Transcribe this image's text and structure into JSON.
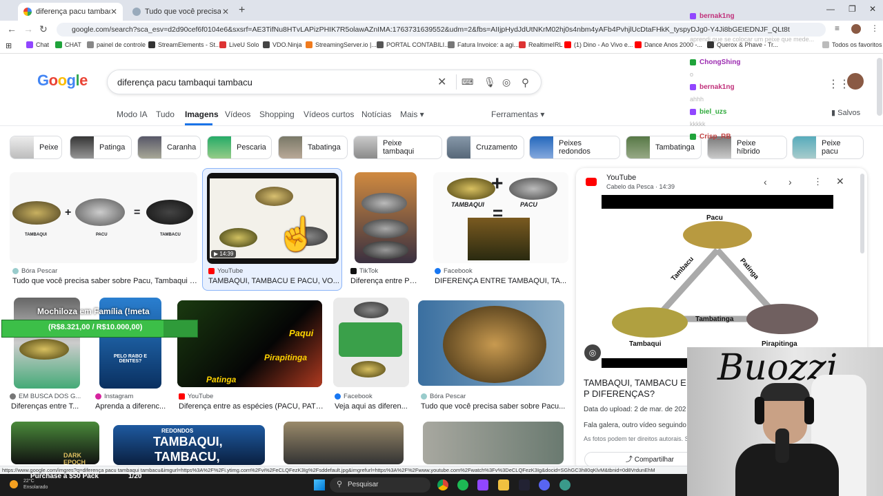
{
  "browser": {
    "tabs": [
      {
        "title": "diferença pacu tambaqui tamba",
        "active": true
      },
      {
        "title": "Tudo que você precisa saber sob",
        "active": false
      }
    ],
    "url": "google.com/search?sca_esv=d2d90cef6f0104e6&sxsrf=AE3TifNu8HTvLAPizPHIK7R5olawAZnIMA:1763731639552&udm=2&fbs=AIIjpHydJdUtNKrM02hj0s4nbm4yAFb4PvhjlUcDtaFHkK_tyspyDJg0-Y4Ji8bGEtEDNJF_QLt8t",
    "status_url": "https://www.google.com/imgres?q=diferença pacu tambaqui tambacu&imgurl=https%3A%2F%2Fi.ytimg.com%2Fvi%2FeCLQFezK3Ig%2Fsddefault.jpg&imgrefurl=https%3A%2F%2Fwww.youtube.com%2Fwatch%3Fv%3DeCLQFezK3Ig&docid=SGhGC3h80qKlvM&tbnid=0d8VrdunEhM",
    "bookmarks": [
      "Chat",
      "CHAT",
      "painel de controle",
      "StreamElements - St...",
      "LiveU Solo",
      "VDO.Ninja",
      "StreamingServer.io |...",
      "PORTAL CONTABILI...",
      "Fatura Invoice: a agi...",
      "RealtimeIRL",
      "(1) Dino - Ao Vivo e...",
      "Dance Anos 2000 -...",
      "Querox & Phave - Tr..."
    ],
    "bookmarks_all": "Todos os favoritos"
  },
  "google": {
    "logo": "Google",
    "query": "diferença pacu tambaqui tambacu",
    "tabs": [
      "Modo IA",
      "Tudo",
      "Imagens",
      "Vídeos",
      "Shopping",
      "Vídeos curtos",
      "Notícias",
      "Mais"
    ],
    "active_tab": "Imagens",
    "tools": "Ferramentas",
    "saved": "Salvos",
    "chips": [
      "Peixe",
      "Patinga",
      "Caranha",
      "Pescaria",
      "Tabatinga",
      "Peixe tambaqui",
      "Cruzamento",
      "Peixes redondos",
      "Tambatinga",
      "Peixe híbrido",
      "Peixe pacu"
    ],
    "results_row1": [
      {
        "source": "Bóra Pescar",
        "title": "Tudo que você precisa saber sobre Pacu, Tambaqui e..."
      },
      {
        "source": "YouTube",
        "title": "TAMBAQUI, TAMBACU E PACU, VO...",
        "duration": "14:39"
      },
      {
        "source": "TikTok",
        "title": "Diferença entre Pa..."
      },
      {
        "source": "Facebook",
        "title": "DIFERENÇA ENTRE TAMBAQUI, TA..."
      }
    ],
    "results_row2": [
      {
        "source": "EM BUSCA DOS G...",
        "title": "Diferenças entre T..."
      },
      {
        "source": "Instagram",
        "title": "Aprenda a diferenc..."
      },
      {
        "source": "YouTube",
        "title": "Diferença entre as espécies (PACU, PATI..."
      },
      {
        "source": "Facebook",
        "title": "Veja aqui as diferen..."
      },
      {
        "source": "Bóra Pescar",
        "title": "Tudo que você precisa saber sobre Pacu..."
      }
    ],
    "image_labels": {
      "tambaqui": "TAMBAQUI",
      "pacu": "PACU",
      "tambacu": "TAMBACU",
      "paqui": "Paqui",
      "pirapitinga": "Pirapitinga",
      "patinga": "Patinga",
      "redondos": "REDONDOS",
      "tambaqui2": "TAMBAQUI,",
      "tambacu2": "TAMBACU,",
      "dark_epoch": "DARK EPOCH",
      "familia": "PELO RABO E DENTES?"
    }
  },
  "panel": {
    "site": "YouTube",
    "channel_time": "Cabelo da Pesca · 14:39",
    "labels": {
      "pacu": "Pacu",
      "tambacu": "Tambacu",
      "patinga": "Patinga",
      "tambatinga": "Tambatinga",
      "tambaqui": "Tambaqui",
      "pirapitinga": "Pirapitinga"
    },
    "heading": "TAMBAQUI, TAMBACU E P DIFERENÇAS?",
    "date": "Data do upload: 2 de mar. de 202",
    "desc": "Fala galera, outro vídeo seguindo",
    "rights": "As fotos podem ter direitos autorais. Sa",
    "share": "Compartilhar"
  },
  "stream": {
    "chat": [
      {
        "user": "bernak1ng",
        "color": "#c0307a",
        "msg": "aprendi que se colocar um peixe que mede..."
      },
      {
        "user": "ChongShing",
        "color": "#9b2bb0",
        "msg": "o"
      },
      {
        "user": "bernak1ng",
        "color": "#c0307a",
        "msg": "ahhh"
      },
      {
        "user": "biel_uzs",
        "color": "#2faa3c",
        "msg": "kkkkk"
      },
      {
        "user": "Crisp_RB",
        "color": "#c04040",
        "msg": ""
      }
    ],
    "goal_title": "Mochiloza em Família (!meta",
    "goal_amount": "(R$8.321,00 / R$10.000,00)",
    "cam_text": "Buozzi",
    "taskbar": {
      "weather": "22°C Ensolarado",
      "promo": "Purchase a $50 Pack",
      "counter": "1/20",
      "search": "Pesquisar"
    }
  }
}
